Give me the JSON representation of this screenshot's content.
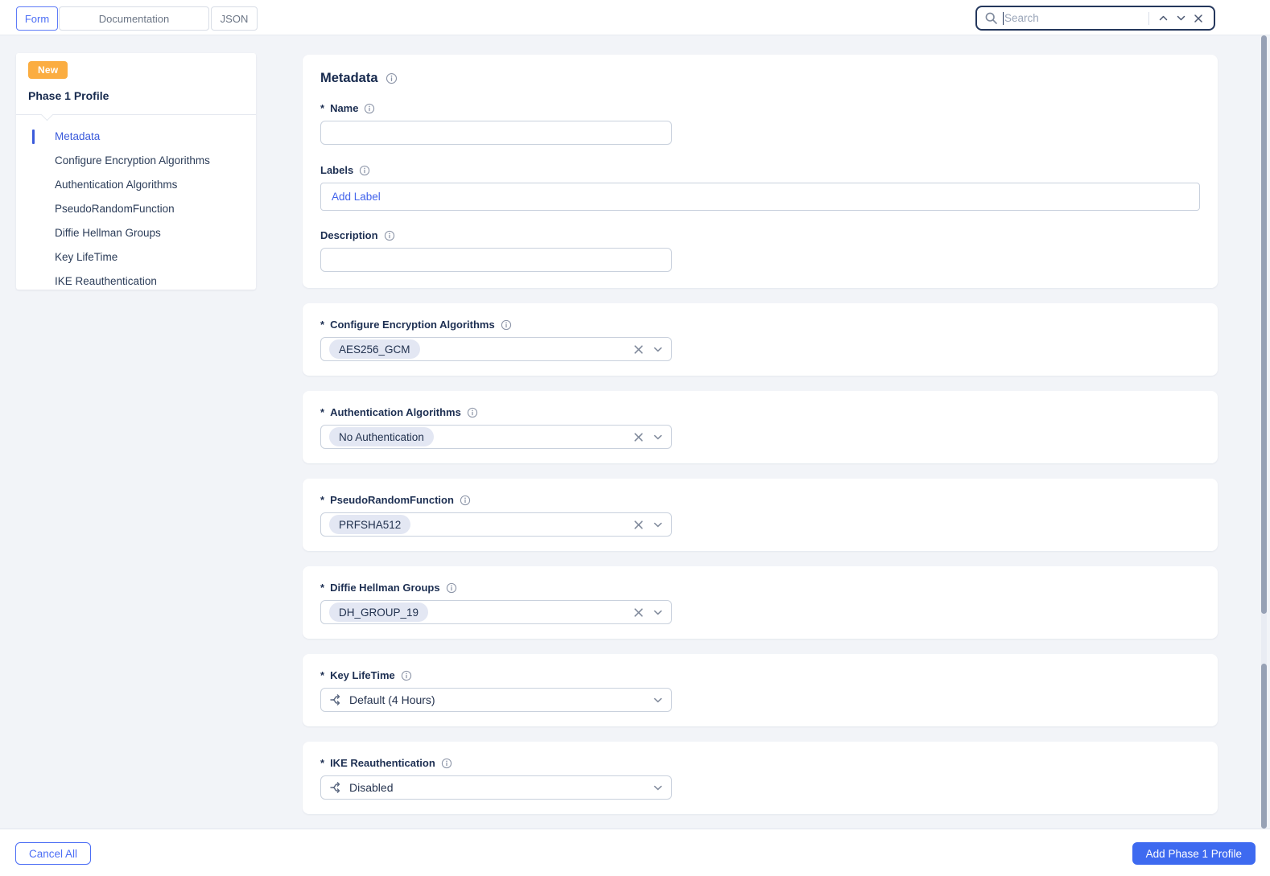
{
  "ui": {
    "required_marker": "*"
  },
  "colors": {
    "accent_blue": "#4c6ef5",
    "link_blue": "#4263eb",
    "active_nav_blue": "#3b5bdb",
    "submit_button_blue": "#3e6af0",
    "badge_orange": "#fbad41",
    "chip_background": "#e3e7f3",
    "navy_text": "#16294d",
    "page_background": "#f2f4f8"
  },
  "header": {
    "tabs": [
      {
        "label": "Form",
        "active": true
      },
      {
        "label": "Documentation",
        "active": false
      },
      {
        "label": "JSON",
        "active": false
      }
    ],
    "search": {
      "placeholder": "Search",
      "value": ""
    }
  },
  "sidebar": {
    "badge": "New",
    "title": "Phase 1 Profile",
    "items": [
      {
        "label": "Metadata",
        "active": true
      },
      {
        "label": "Configure Encryption Algorithms",
        "active": false
      },
      {
        "label": "Authentication Algorithms",
        "active": false
      },
      {
        "label": "PseudoRandomFunction",
        "active": false
      },
      {
        "label": "Diffie Hellman Groups",
        "active": false
      },
      {
        "label": "Key LifeTime",
        "active": false
      },
      {
        "label": "IKE Reauthentication",
        "active": false
      }
    ]
  },
  "form": {
    "metadata_card": {
      "title": "Metadata",
      "name_label": "Name",
      "name_value": "",
      "labels_label": "Labels",
      "labels_placeholder": "Add Label",
      "description_label": "Description",
      "description_value": ""
    },
    "select_cards": [
      {
        "label": "Configure Encryption Algorithms",
        "required": true,
        "type": "multiselect",
        "chip": "AES256_GCM"
      },
      {
        "label": "Authentication Algorithms",
        "required": true,
        "type": "multiselect",
        "chip": "No Authentication"
      },
      {
        "label": "PseudoRandomFunction",
        "required": true,
        "type": "multiselect",
        "chip": "PRFSHA512"
      },
      {
        "label": "Diffie Hellman Groups",
        "required": true,
        "type": "multiselect",
        "chip": "DH_GROUP_19"
      },
      {
        "label": "Key LifeTime",
        "required": true,
        "type": "dropdown",
        "value": "Default (4 Hours)"
      },
      {
        "label": "IKE Reauthentication",
        "required": true,
        "type": "dropdown",
        "value": "Disabled"
      }
    ]
  },
  "footer": {
    "cancel_label": "Cancel All",
    "submit_label": "Add Phase 1 Profile"
  }
}
